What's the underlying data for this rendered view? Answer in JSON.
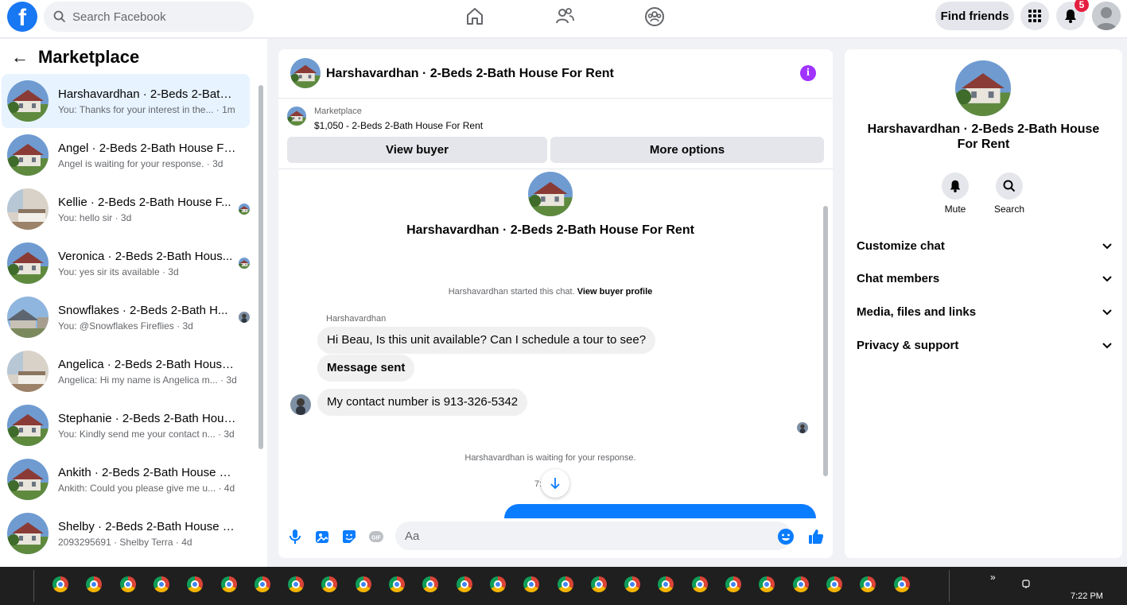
{
  "topbar": {
    "search_placeholder": "Search Facebook",
    "find_friends_label": "Find friends",
    "notification_count": "5"
  },
  "left": {
    "title": "Marketplace",
    "conversations": [
      {
        "name": "Harshavardhan · 2-Beds 2-Bath ...",
        "sub": "You: Thanks for your interest in the... · 1m",
        "thumb": "house"
      },
      {
        "name": "Angel · 2-Beds 2-Bath House For...",
        "sub": "Angel is waiting for your response. · 3d",
        "thumb": "house"
      },
      {
        "name": "Kellie · 2-Beds 2-Bath House F...",
        "sub": "You: hello sir · 3d",
        "thumb": "bedroom"
      },
      {
        "name": "Veronica · 2-Beds 2-Bath Hous...",
        "sub": "You: yes sir its available · 3d",
        "thumb": "house"
      },
      {
        "name": "Snowflakes · 2-Beds 2-Bath H...",
        "sub": "You: @Snowflakes Fireflies · 3d",
        "thumb": "suburb"
      },
      {
        "name": "Angelica · 2-Beds 2-Bath House ...",
        "sub": "Angelica: Hi my name is Angelica m... · 3d",
        "thumb": "bedroom"
      },
      {
        "name": "Stephanie · 2-Beds 2-Bath Hous...",
        "sub": "You: Kindly send me your contact n... · 3d",
        "thumb": "house"
      },
      {
        "name": "Ankith · 2-Beds 2-Bath House Fo...",
        "sub": "Ankith: Could you please give me u... · 4d",
        "thumb": "house"
      },
      {
        "name": "Shelby · 2-Beds 2-Bath House Fo...",
        "sub": "2093295691 · Shelby Terra · 4d",
        "thumb": "house"
      }
    ]
  },
  "chat": {
    "title": "Harshavardhan · 2-Beds 2-Bath House For Rent",
    "marketplace_label": "Marketplace",
    "listing": "$1,050 - 2-Beds 2-Bath House For Rent",
    "view_buyer": "View buyer",
    "more_options": "More options",
    "conversation_title": "Harshavardhan · 2-Beds 2-Bath House For Rent",
    "started_text": "Harshavardhan started this chat.",
    "view_profile": "View buyer profile",
    "sender_name": "Harshavardhan",
    "messages": [
      "Hi Beau, Is this unit available? Can I schedule a tour to see?",
      "Message sent",
      "My contact number is 913-326-5342"
    ],
    "waiting_text": "Harshavardhan is waiting for your response.",
    "time_partial": "7:",
    "input_placeholder": "Aa"
  },
  "details": {
    "name": "Harshavardhan · 2-Beds 2-Bath House For Rent",
    "mute_label": "Mute",
    "search_label": "Search",
    "sections": [
      "Customize chat",
      "Chat members",
      "Media, files and links",
      "Privacy & support"
    ]
  },
  "taskbar": {
    "clock": "7:22 PM",
    "overflow": "»"
  },
  "colors": {
    "brand_blue": "#1877f2",
    "active_row": "#e7f3ff",
    "info_purple": "#a033ff",
    "badge_red": "#e41e3f",
    "outgoing_bubble": "#0a7cff"
  }
}
